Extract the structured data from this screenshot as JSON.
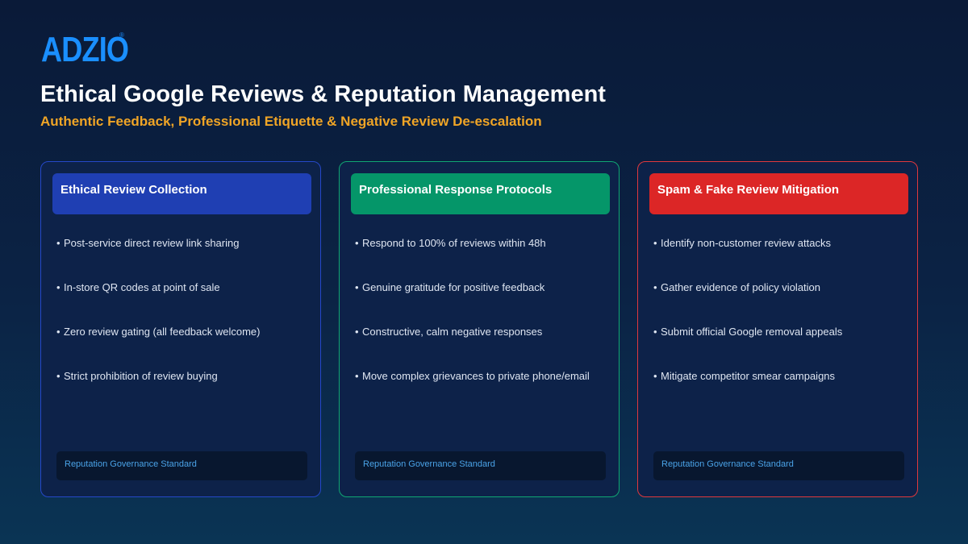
{
  "brand": {
    "name": "ADZIO",
    "registered_mark": "®",
    "color": "#1a8fff"
  },
  "header": {
    "title": "Ethical Google Reviews & Reputation Management",
    "subtitle": "Authentic Feedback, Professional Etiquette & Negative Review De-escalation",
    "subtitle_color": "#f0a526"
  },
  "cards": [
    {
      "title": "Ethical Review Collection",
      "accent": "#1f3fb3",
      "border": "#2548c8",
      "items": [
        "Post-service direct review link sharing",
        "In-store QR codes at point of sale",
        "Zero review gating (all feedback welcome)",
        "Strict prohibition of review buying"
      ],
      "footer": "Reputation Governance Standard"
    },
    {
      "title": "Professional Response Protocols",
      "accent": "#059669",
      "border": "#10a673",
      "items": [
        "Respond to 100% of reviews within 48h",
        "Genuine gratitude for positive feedback",
        "Constructive, calm negative responses",
        "Move complex grievances to private phone/email"
      ],
      "footer": "Reputation Governance Standard"
    },
    {
      "title": "Spam & Fake Review Mitigation",
      "accent": "#dc2626",
      "border": "#e0383d",
      "items": [
        "Identify non-customer review attacks",
        "Gather evidence of policy violation",
        "Submit official Google removal appeals",
        "Mitigate competitor smear campaigns"
      ],
      "footer": "Reputation Governance Standard"
    }
  ]
}
